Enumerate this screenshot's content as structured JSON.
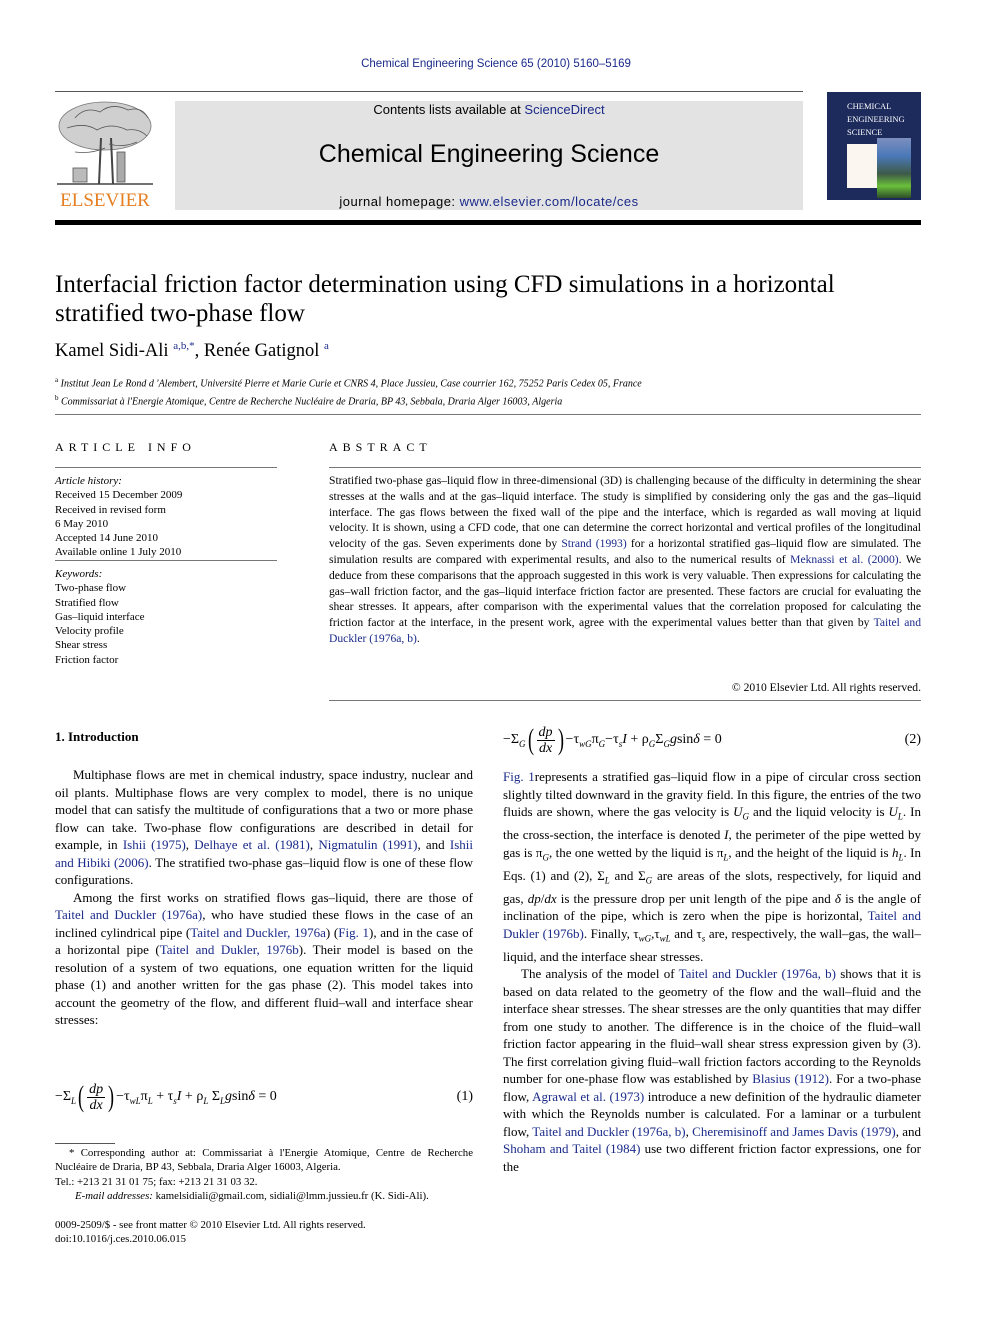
{
  "header": {
    "journal_ref": "Chemical Engineering Science 65 (2010) 5160–5169",
    "contents_prefix": "Contents lists available at ",
    "contents_link": "ScienceDirect",
    "journal_title": "Chemical Engineering Science",
    "homepage_prefix": "journal homepage: ",
    "homepage_link": "www.elsevier.com/locate/ces",
    "publisher_logo": "ELSEVIER",
    "cover_title_lines": [
      "CHEMICAL",
      "ENGINEERING",
      "SCIENCE"
    ]
  },
  "article": {
    "title": "Interfacial friction factor determination using CFD simulations in a horizontal stratified two-phase flow",
    "authors": [
      {
        "name": "Kamel Sidi-Ali",
        "sup": "a,b,",
        "corresponding": "*"
      },
      {
        "name": "Renée Gatignol",
        "sup": "a"
      }
    ],
    "affiliations": [
      {
        "mark": "a",
        "text": "Institut Jean Le Rond d 'Alembert, Université Pierre et Marie Curie et CNRS 4, Place Jussieu, Case courrier 162, 75252 Paris Cedex 05, France"
      },
      {
        "mark": "b",
        "text": "Commissariat à l'Energie Atomique, Centre de Recherche Nucléaire de Draria, BP 43, Sebbala, Draria Alger 16003, Algeria"
      }
    ]
  },
  "article_info": {
    "heading": "ARTICLE INFO",
    "history_label": "Article history:",
    "history": [
      "Received 15 December 2009",
      "Received in revised form",
      "6 May 2010",
      "Accepted 14 June 2010",
      "Available online 1 July 2010"
    ],
    "keywords_label": "Keywords:",
    "keywords": [
      "Two-phase flow",
      "Stratified flow",
      "Gas–liquid interface",
      "Velocity profile",
      "Shear stress",
      "Friction factor"
    ]
  },
  "abstract": {
    "heading": "ABSTRACT",
    "segments": [
      {
        "t": "Stratified two-phase gas–liquid flow in three-dimensional (3D) is challenging because of the difficulty in determining the shear stresses at the walls and at the gas–liquid interface. The study is simplified by considering only the gas and the gas–liquid interface. The gas flows between the fixed wall of the pipe and the interface, which is regarded as wall moving at liquid velocity. It is shown, using a CFD code, that one can determine the correct horizontal and vertical profiles of the longitudinal velocity of the gas. Seven experiments done by "
      },
      {
        "t": "Strand (1993)",
        "link": true
      },
      {
        "t": " for a horizontal stratified gas–liquid flow are simulated. The simulation results are compared with experimental results, and also to the numerical results of "
      },
      {
        "t": "Meknassi et al. (2000)",
        "link": true
      },
      {
        "t": ". We deduce from these comparisons that the approach suggested in this work is very valuable. Then expressions for calculating the gas–wall friction factor, and the gas–liquid interface friction factor are presented. These factors are crucial for evaluating the shear stresses. It appears, after comparison with the experimental values that the correlation proposed for calculating the friction factor at the interface, in the present work, agree with the experimental values better than that given by "
      },
      {
        "t": "Taitel and Duckler (1976a, b)",
        "link": true
      },
      {
        "t": "."
      }
    ],
    "copyright": "© 2010 Elsevier Ltd. All rights reserved."
  },
  "introduction": {
    "heading": "1.  Introduction",
    "para1": [
      {
        "t": "Multiphase flows are met in chemical industry, space industry, nuclear and oil plants. Multiphase flows are very complex to model, there is no unique model that can satisfy the multitude of configurations that a two or more phase flow can take. Two-phase flow configurations are described in detail for example, in "
      },
      {
        "t": "Ishii (1975)",
        "link": true
      },
      {
        "t": ", "
      },
      {
        "t": "Delhaye et al. (1981)",
        "link": true
      },
      {
        "t": ", "
      },
      {
        "t": "Nigmatulin (1991)",
        "link": true
      },
      {
        "t": ", and "
      },
      {
        "t": "Ishii and Hibiki (2006)",
        "link": true
      },
      {
        "t": ". The stratified two-phase gas–liquid flow is one of these flow configurations."
      }
    ],
    "para2": [
      {
        "t": "Among the first works on stratified flows gas–liquid, there are those of "
      },
      {
        "t": "Taitel and Duckler (1976a)",
        "link": true
      },
      {
        "t": ", who have studied these flows in the case of an inclined cylindrical pipe ("
      },
      {
        "t": "Taitel and Duckler, 1976a",
        "link": true
      },
      {
        "t": ") ("
      },
      {
        "t": "Fig. 1",
        "link": true
      },
      {
        "t": "), and in the case of a horizontal pipe ("
      },
      {
        "t": "Taitel and Dukler, 1976b",
        "link": true
      },
      {
        "t": "). Their model is based on the resolution of a system of two equations, one equation written for the liquid phase (1) and another written for the gas phase (2). This model takes into account the geometry of the flow, and different fluid–wall and interface shear stresses:"
      }
    ],
    "eq1_number": "(1)",
    "eq2_number": "(2)",
    "right_para1_link": "Fig. 1",
    "right_para2": [
      {
        "t": "The analysis of the model of "
      },
      {
        "t": "Taitel and Duckler (1976a, b)",
        "link": true
      },
      {
        "t": " shows that it is based on data related to the geometry of the flow and the wall–fluid and the interface shear stresses. The shear stresses are the only quantities that may differ from one study to another. The difference is in the choice of the fluid–wall friction factor appearing in the fluid–wall shear stress expression given by (3). The first correlation giving fluid–wall friction factors according to the Reynolds number for one-phase flow was established by "
      },
      {
        "t": "Blasius (1912)",
        "link": true
      },
      {
        "t": ". For a two-phase flow, "
      },
      {
        "t": "Agrawal et al. (1973)",
        "link": true
      },
      {
        "t": " introduce a new definition of the hydraulic diameter with which the Reynolds number is calculated. For a laminar or a turbulent flow, "
      },
      {
        "t": "Taitel and Duckler (1976a, b)",
        "link": true
      },
      {
        "t": ", "
      },
      {
        "t": "Cheremisinoff and James Davis (1979)",
        "link": true
      },
      {
        "t": ", and "
      },
      {
        "t": "Shoham and Taitel (1984)",
        "link": true
      },
      {
        "t": " use two different friction factor expressions, one for the"
      }
    ]
  },
  "footnote": {
    "corresponding": "* Corresponding author at: Commissariat à l'Energie Atomique, Centre de Recherche Nucléaire de Draria, BP 43, Sebbala, Draria Alger 16003, Algeria.",
    "phone": "Tel.: +213 21 31 01 75; fax: +213 21 31 03 32.",
    "email_label": "E-mail addresses:",
    "email_text": " kamelsidiali@gmail.com, sidiali@lmm.jussieu.fr (K. Sidi-Ali)."
  },
  "front_matter": {
    "issn_line": "0009-2509/$ - see front matter © 2010 Elsevier Ltd. All rights reserved.",
    "doi": "doi:10.1016/j.ces.2010.06.015"
  }
}
